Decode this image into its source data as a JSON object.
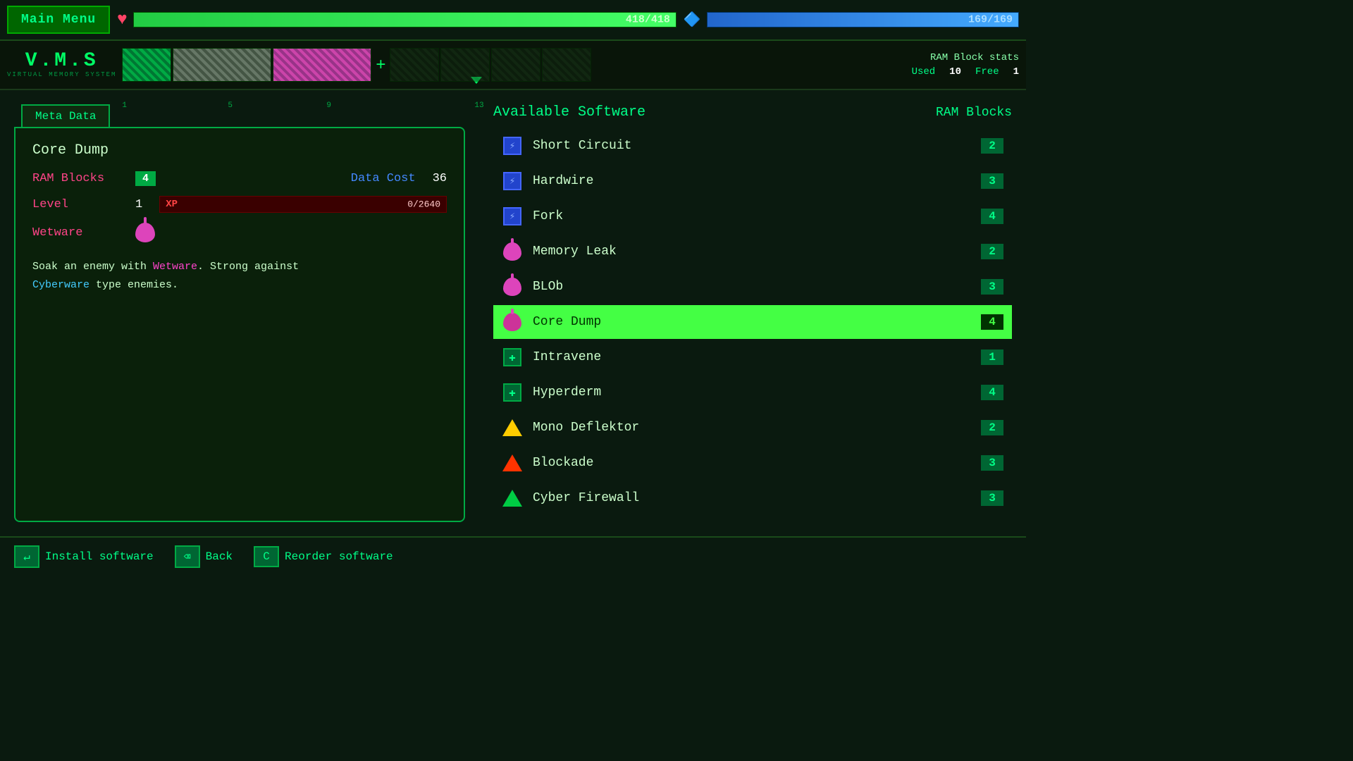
{
  "header": {
    "main_menu_label": "Main Menu",
    "hp_current": "418",
    "hp_max": "418",
    "hp_text": "418/418",
    "mp_current": "169",
    "mp_max": "169",
    "mp_text": "169/169"
  },
  "vms": {
    "title": "V.M.S",
    "subtitle": "VIRTUAL MEMORY SYSTEM",
    "ram_stats_title": "RAM Block stats",
    "ram_used_label": "Used",
    "ram_used_value": "10",
    "ram_free_label": "Free",
    "ram_free_value": "1",
    "numbers": [
      "1",
      "5",
      "9",
      "13"
    ]
  },
  "meta": {
    "tab_label": "Meta Data",
    "item_name": "Core Dump",
    "ram_blocks_label": "RAM Blocks",
    "ram_blocks_value": "4",
    "data_cost_label": "Data Cost",
    "data_cost_value": "36",
    "level_label": "Level",
    "level_value": "1",
    "xp_label": "XP",
    "xp_current": "0",
    "xp_max": "2640",
    "xp_text": "0/2640",
    "wetware_label": "Wetware",
    "description_line1": "Soak an enemy with ",
    "description_wetware": "Wetware",
    "description_line2": ". Strong against",
    "description_line3": "Cyberware",
    "description_line4": " type enemies."
  },
  "software": {
    "title": "Available Software",
    "ram_blocks_header": "RAM Blocks",
    "items": [
      {
        "name": "Short Circuit",
        "ram": "2",
        "icon_type": "circuit",
        "selected": false
      },
      {
        "name": "Hardwire",
        "ram": "3",
        "icon_type": "circuit",
        "selected": false
      },
      {
        "name": "Fork",
        "ram": "4",
        "icon_type": "circuit",
        "selected": false
      },
      {
        "name": "Memory Leak",
        "ram": "2",
        "icon_type": "wetware",
        "selected": false
      },
      {
        "name": "BLOb",
        "ram": "3",
        "icon_type": "wetware",
        "selected": false
      },
      {
        "name": "Core Dump",
        "ram": "4",
        "icon_type": "wetware",
        "selected": true
      },
      {
        "name": "Intravene",
        "ram": "1",
        "icon_type": "medic",
        "selected": false
      },
      {
        "name": "Hyperderm",
        "ram": "4",
        "icon_type": "medic",
        "selected": false
      },
      {
        "name": "Mono Deflektor",
        "ram": "2",
        "icon_type": "triangle_yellow",
        "selected": false
      },
      {
        "name": "Blockade",
        "ram": "3",
        "icon_type": "triangle_red",
        "selected": false
      },
      {
        "name": "Cyber Firewall",
        "ram": "3",
        "icon_type": "triangle_green",
        "selected": false
      }
    ]
  },
  "bottom": {
    "install_key": "↵",
    "install_label": "Install software",
    "back_key": "⌫",
    "back_label": "Back",
    "reorder_key": "C",
    "reorder_label": "Reorder software"
  }
}
